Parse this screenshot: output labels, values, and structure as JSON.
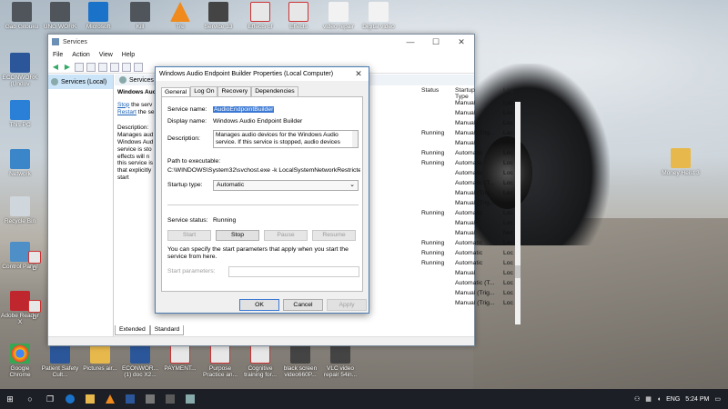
{
  "desktop": {
    "icons": [
      {
        "label": "Gab Gitouku",
        "icon": "image-icon"
      },
      {
        "label": "UNG WORK",
        "icon": "image-icon"
      },
      {
        "label": "Microsoft",
        "icon": "edge-icon"
      },
      {
        "label": "Kill",
        "icon": "image-icon"
      },
      {
        "label": "Tre",
        "icon": "vlc-icon"
      },
      {
        "label": "Service 33",
        "icon": "video-icon"
      },
      {
        "label": "Effects of",
        "icon": "pdf-icon"
      },
      {
        "label": "Effects",
        "icon": "pdf-icon"
      },
      {
        "label": "video repair",
        "icon": "doc-icon"
      },
      {
        "label": "Digital video",
        "icon": "doc-icon"
      },
      {
        "label": "ECONWORK (Undov",
        "icon": "word-icon"
      },
      {
        "label": "This PC",
        "icon": "pc-icon"
      },
      {
        "label": "Network",
        "icon": "network-icon"
      },
      {
        "label": "Recycle Bin",
        "icon": "recycle-bin-icon"
      },
      {
        "label": "Control Panel",
        "icon": "control-panel-icon"
      },
      {
        "label": "D",
        "icon": "pdf-icon"
      },
      {
        "label": "Adobe Reader X",
        "icon": "adobe-icon"
      },
      {
        "label": "D",
        "icon": "pdf-icon"
      },
      {
        "label": "Money Heist 3",
        "icon": "folder-icon"
      },
      {
        "label": "Google Chrome",
        "icon": "chrome-icon"
      },
      {
        "label": "Patient Safety Cult...",
        "icon": "word-icon"
      },
      {
        "label": "Pictures air...",
        "icon": "folder-icon"
      },
      {
        "label": "ECONWOR... (1) doc X2...",
        "icon": "word-icon"
      },
      {
        "label": "PAYMENT...",
        "icon": "pdf-icon"
      },
      {
        "label": "Purpose Practice an...",
        "icon": "pdf-icon"
      },
      {
        "label": "Cognitive training for...",
        "icon": "pdf-icon"
      },
      {
        "label": "black screen video660P...",
        "icon": "video-icon"
      },
      {
        "label": "VLC video repair 54in...",
        "icon": "video-icon"
      }
    ]
  },
  "services_window": {
    "title": "Services",
    "controls": [
      "—",
      "☐",
      "✕"
    ],
    "menu": [
      "File",
      "Action",
      "View",
      "Help"
    ],
    "tree_item": "Services (Local)",
    "pane_header": "Services (Local)",
    "desc_pane": {
      "title": "Windows Aud",
      "stop_link": "Stop",
      "stop_rest": " the serv",
      "restart_link": "Restart",
      "restart_rest": " the se",
      "desc_label": "Description:",
      "desc_lines": [
        "Manages aud",
        "Windows Aud",
        "service is sto",
        "effects will n",
        "this service is",
        "that explicitly",
        "start"
      ]
    },
    "columns": {
      "status": "Status",
      "startup": "Startup Type",
      "logon": "Log"
    },
    "rows": [
      {
        "status": "",
        "startup": "Manual",
        "logon": "Loc"
      },
      {
        "status": "",
        "startup": "Manual",
        "logon": "Loc"
      },
      {
        "status": "",
        "startup": "Manual",
        "logon": "Loc"
      },
      {
        "status": "Running",
        "startup": "Manual (Trig...",
        "logon": "Loc"
      },
      {
        "status": "",
        "startup": "Manual",
        "logon": "Loc"
      },
      {
        "status": "Running",
        "startup": "Automatic",
        "logon": "Loc"
      },
      {
        "status": "Running",
        "startup": "Automatic",
        "logon": "Loc"
      },
      {
        "status": "",
        "startup": "Automatic",
        "logon": "Loc"
      },
      {
        "status": "",
        "startup": "Automatic (T...",
        "logon": "Loc"
      },
      {
        "status": "",
        "startup": "Manual (Trig...",
        "logon": "Loc"
      },
      {
        "status": "",
        "startup": "Manual (Trig...",
        "logon": "Loc"
      },
      {
        "status": "Running",
        "startup": "Automatic",
        "logon": "Loc"
      },
      {
        "status": "",
        "startup": "Manual",
        "logon": "Loc"
      },
      {
        "status": "",
        "startup": "Manual",
        "logon": "Net"
      },
      {
        "status": "Running",
        "startup": "Automatic",
        "logon": "Loc"
      },
      {
        "status": "Running",
        "startup": "Automatic",
        "logon": "Loc"
      },
      {
        "status": "Running",
        "startup": "Automatic",
        "logon": "Loc"
      },
      {
        "status": "",
        "startup": "Manual",
        "logon": "Loc"
      },
      {
        "status": "",
        "startup": "Automatic (T...",
        "logon": "Loc"
      },
      {
        "status": "",
        "startup": "Manual (Trig...",
        "logon": "Loc"
      },
      {
        "status": "",
        "startup": "Manual (Trig...",
        "logon": "Loc"
      }
    ],
    "tabs": [
      "Extended",
      "Standard"
    ]
  },
  "dialog": {
    "title": "Windows Audio Endpoint Builder Properties (Local Computer)",
    "close": "✕",
    "tabs": [
      "General",
      "Log On",
      "Recovery",
      "Dependencies"
    ],
    "service_name_label": "Service name:",
    "service_name": "AudioEndpointBuilder",
    "display_name_label": "Display name:",
    "display_name": "Windows Audio Endpoint Builder",
    "description_label": "Description:",
    "description": "Manages audio devices for the Windows Audio service.  If this service is stopped, audio devices",
    "path_label": "Path to executable:",
    "path": "C:\\WINDOWS\\System32\\svchost.exe -k LocalSystemNetworkRestricted -p",
    "startup_label": "Startup type:",
    "startup_value": "Automatic",
    "status_label": "Service status:",
    "status_value": "Running",
    "buttons": {
      "start": "Start",
      "stop": "Stop",
      "pause": "Pause",
      "resume": "Resume"
    },
    "hint": "You can specify the start parameters that apply when you start the service from here.",
    "params_label": "Start parameters:",
    "ok": "OK",
    "cancel": "Cancel",
    "apply": "Apply"
  },
  "taskbar": {
    "time": "5:24 PM",
    "lang": "ENG"
  }
}
